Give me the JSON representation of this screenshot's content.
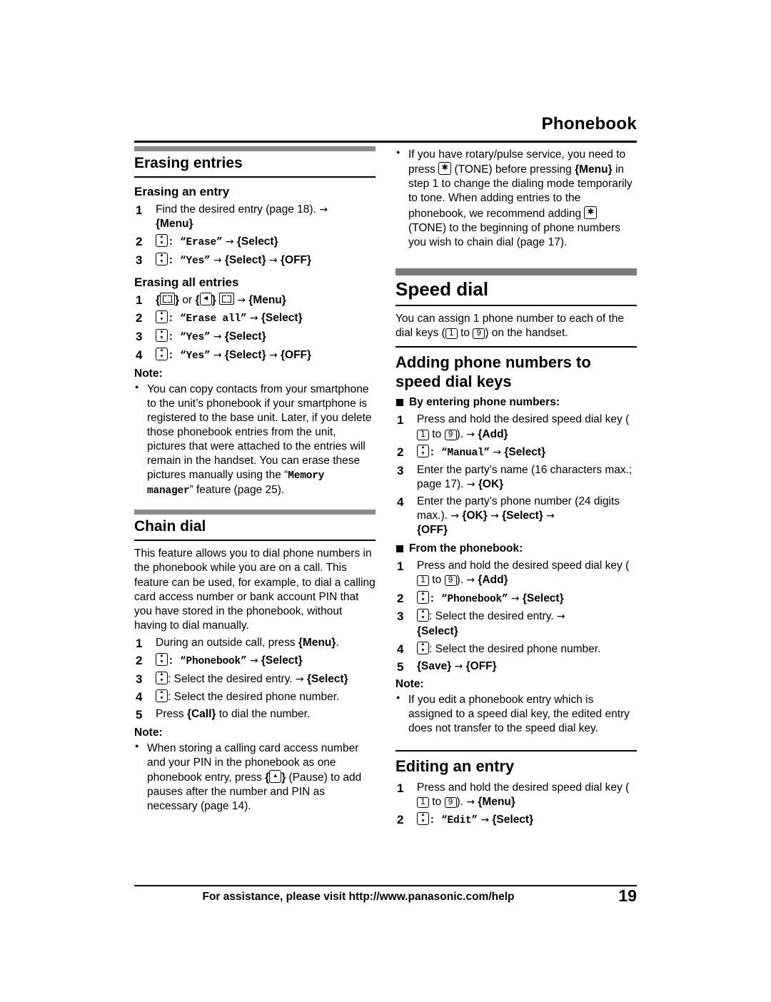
{
  "header": {
    "title": "Phonebook"
  },
  "footer": {
    "assistance": "For assistance, please visit http://www.panasonic.com/help",
    "page_number": "19"
  },
  "left_column": {
    "section1": {
      "title": "Erasing entries",
      "sub1": {
        "title": "Erasing an entry",
        "steps": [
          {
            "num": "1",
            "text_1": "Find the desired entry (page 18). ",
            "arrow": "→",
            "bracket": "{Menu}"
          },
          {
            "num": "2",
            "mono1": "“Erase”",
            "arrow": "→",
            "bracket": "{Select}"
          },
          {
            "num": "3",
            "mono1": "“Yes”",
            "arrow": "→",
            "bracket": "{Select}",
            "arrow2": "→",
            "bracket2": "{OFF}"
          }
        ]
      },
      "sub2": {
        "title": "Erasing all entries",
        "steps": [
          {
            "num": "1",
            "text": "or",
            "arrow": "→",
            "bracket": "{Menu}"
          },
          {
            "num": "2",
            "mono1": "“Erase all”",
            "arrow": "→",
            "bracket": "{Select}"
          },
          {
            "num": "3",
            "mono1": "“Yes”",
            "arrow": "→",
            "bracket": "{Select}"
          },
          {
            "num": "4",
            "mono1": "“Yes”",
            "arrow": "→",
            "bracket": "{Select}",
            "arrow2": "→",
            "bracket2": "{OFF}"
          }
        ]
      },
      "note_label": "Note:",
      "note_text_a": "You can copy contacts from your smartphone to the unit’s phonebook if your smartphone is registered to the base unit. Later, if you delete those phonebook entries from the unit, pictures that were attached to the entries will remain in the handset. You can erase these pictures manually using the “",
      "note_mono": "Memory manager",
      "note_text_b": "” feature (page 25)."
    },
    "section2": {
      "title": "Chain dial",
      "body": "This feature allows you to dial phone numbers in the phonebook while you are on a call. This feature can be used, for example, to dial a calling card access number or bank account PIN that you have stored in the phonebook, without having to dial manually.",
      "steps": [
        {
          "num": "1",
          "text": "During an outside call, press ",
          "bracket": "{Menu}",
          "tail": "."
        },
        {
          "num": "2",
          "mono1": "“Phonebook”",
          "arrow": "→",
          "bracket": "{Select}"
        },
        {
          "num": "3",
          "text": ": Select the desired entry. ",
          "arrow": "→",
          "bracket": "{Select}"
        },
        {
          "num": "4",
          "text": ": Select the desired phone number."
        },
        {
          "num": "5",
          "text": "Press ",
          "bracket": "{Call}",
          "tail": " to dial the number."
        }
      ],
      "note_label": "Note:",
      "note_text_a": "When storing a calling card access number and your PIN in the phonebook as one phonebook entry, press ",
      "note_text_b": " (Pause) to add pauses after the number and PIN as necessary (page 14)."
    }
  },
  "right_column": {
    "top_bullet_a": "If you have rotary/pulse service, you need to press ",
    "top_bullet_b": " (TONE) before pressing ",
    "top_bullet_bracket": "{Menu}",
    "top_bullet_c": " in step 1 to change the dialing mode temporarily to tone. When adding entries to the phonebook, we recommend adding ",
    "top_bullet_d": " (TONE) to the beginning of phone numbers you wish to chain dial (page 17).",
    "speed_dial": {
      "title": "Speed dial",
      "body_a": "You can assign 1 phone number to each of the dial keys (",
      "body_key1": "1",
      "body_to": " to ",
      "body_key2": "9",
      "body_b": ") on the handset."
    },
    "adding": {
      "title": "Adding phone numbers to speed dial keys",
      "group1_title": "By entering phone numbers:",
      "group1_steps": [
        {
          "num": "1",
          "text_a": "Press and hold the desired speed dial key (",
          "key1": "1",
          "to": " to ",
          "key2": "9",
          "text_b": "). ",
          "arrow": "→",
          "bracket": "{Add}"
        },
        {
          "num": "2",
          "mono1": "“Manual”",
          "arrow": "→",
          "bracket": "{Select}"
        },
        {
          "num": "3",
          "text_a": "Enter the party’s name (16 characters max.; page 17). ",
          "arrow": "→",
          "bracket": "{OK}"
        },
        {
          "num": "4",
          "text_a": "Enter the party’s phone number (24 digits max.). ",
          "arrow": "→",
          "bracket": "{OK}",
          "arrow2": "→",
          "bracket2": "{Select}",
          "arrow3": "→",
          "bracket3": "{OFF}"
        }
      ],
      "group2_title": "From the phonebook:",
      "group2_steps": [
        {
          "num": "1",
          "text_a": "Press and hold the desired speed dial key (",
          "key1": "1",
          "to": " to ",
          "key2": "9",
          "text_b": "). ",
          "arrow": "→",
          "bracket": "{Add}"
        },
        {
          "num": "2",
          "mono1": "“Phonebook”",
          "arrow": "→",
          "bracket": "{Select}"
        },
        {
          "num": "3",
          "text_a": ": Select the desired entry. ",
          "arrow": "→",
          "bracket": "{Select}"
        },
        {
          "num": "4",
          "text_a": ": Select the desired phone number."
        },
        {
          "num": "5",
          "bracket": "{Save}",
          "arrow": "→",
          "bracket2": "{OFF}"
        }
      ],
      "note_label": "Note:",
      "note_text": "If you edit a phonebook entry which is assigned to a speed dial key, the edited entry does not transfer to the speed dial key."
    },
    "editing": {
      "title": "Editing an entry",
      "steps": [
        {
          "num": "1",
          "text_a": "Press and hold the desired speed dial key (",
          "key1": "1",
          "to": " to ",
          "key2": "9",
          "text_b": "). ",
          "arrow": "→",
          "bracket": "{Menu}"
        },
        {
          "num": "2",
          "mono1": "“Edit”",
          "arrow": "→",
          "bracket": "{Select}"
        }
      ]
    }
  }
}
